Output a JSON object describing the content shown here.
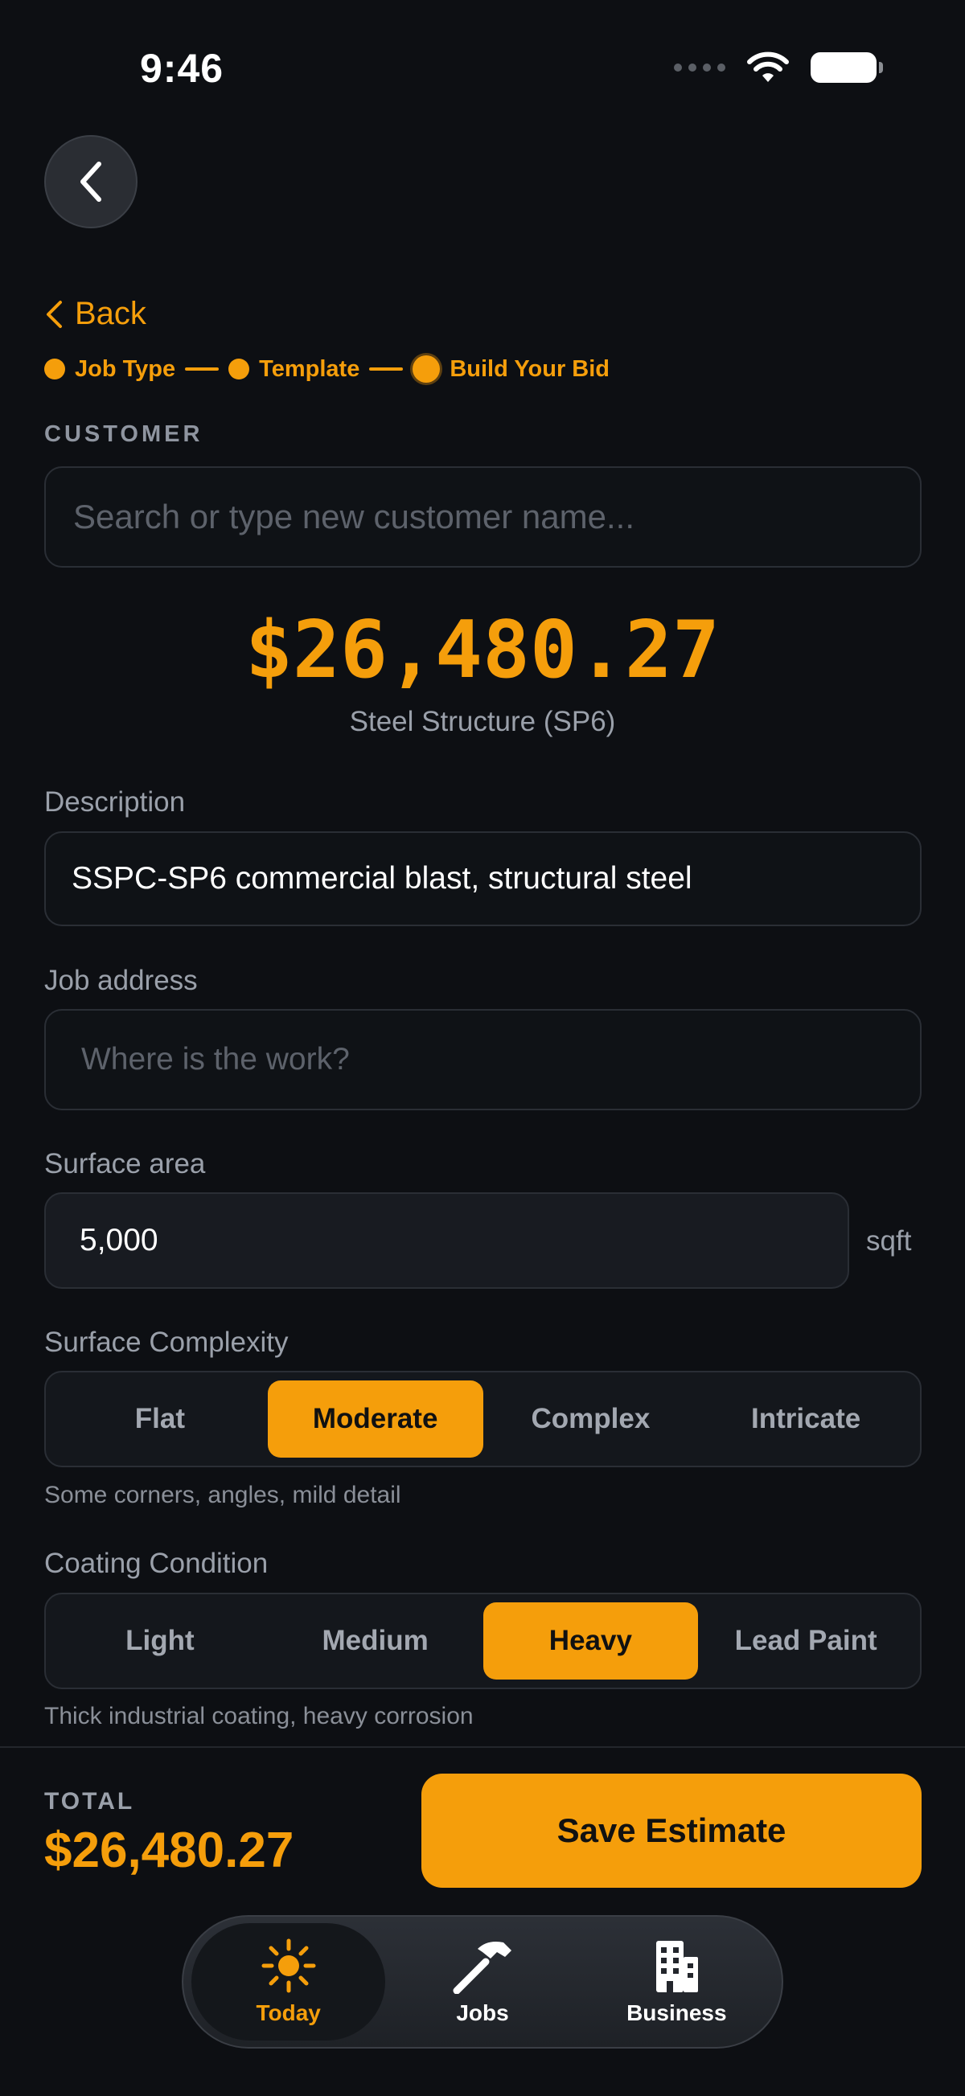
{
  "status_bar": {
    "time": "9:46"
  },
  "nav": {
    "back_label": "Back"
  },
  "steps": [
    {
      "label": "Job Type"
    },
    {
      "label": "Template"
    },
    {
      "label": "Build Your Bid"
    }
  ],
  "customer": {
    "section_label": "CUSTOMER",
    "placeholder": "Search or type new customer name..."
  },
  "estimate": {
    "price": "$26,480.27",
    "subtitle": "Steel Structure (SP6)"
  },
  "description": {
    "label": "Description",
    "value": "SSPC-SP6 commercial blast, structural steel"
  },
  "job_address": {
    "label": "Job address",
    "placeholder": "Where is the work?"
  },
  "surface_area": {
    "label": "Surface area",
    "value": "5,000",
    "unit": "sqft"
  },
  "surface_complexity": {
    "label": "Surface Complexity",
    "options": [
      "Flat",
      "Moderate",
      "Complex",
      "Intricate"
    ],
    "selected": "Moderate",
    "hint": "Some corners, angles, mild detail"
  },
  "coating_condition": {
    "label": "Coating Condition",
    "options": [
      "Light",
      "Medium",
      "Heavy",
      "Lead Paint"
    ],
    "selected": "Heavy",
    "hint": "Thick industrial coating, heavy corrosion"
  },
  "footer": {
    "total_label": "TOTAL",
    "total_value": "$26,480.27",
    "save_label": "Save Estimate"
  },
  "tabbar": {
    "tabs": [
      {
        "label": "Today",
        "icon": "sun-icon",
        "active": true
      },
      {
        "label": "Jobs",
        "icon": "hammer-icon",
        "active": false
      },
      {
        "label": "Business",
        "icon": "building-icon",
        "active": false
      }
    ]
  },
  "colors": {
    "accent": "#f59e0b",
    "background": "#0d0f13"
  }
}
